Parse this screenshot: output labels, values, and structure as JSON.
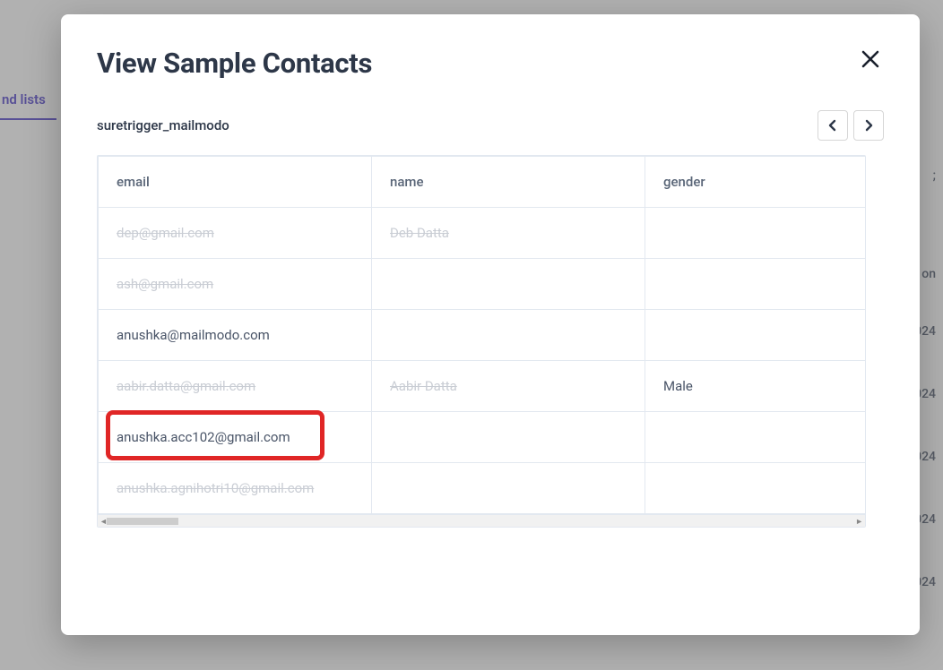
{
  "modal": {
    "title": "View Sample Contacts",
    "subtitle": "suretrigger_mailmodo"
  },
  "background": {
    "tab_label": "nd lists",
    "right_col_header": "on",
    "right_dates": [
      "024",
      "024",
      "024",
      "024",
      "024"
    ]
  },
  "table": {
    "headers": {
      "email": "email",
      "name": "name",
      "gender": "gender"
    },
    "rows": [
      {
        "email": "dep@gmail.com",
        "name": "Deb Datta",
        "gender": "",
        "email_redacted": true,
        "name_redacted": true
      },
      {
        "email": "ash@gmail.com",
        "name": "",
        "gender": "",
        "email_redacted": true,
        "name_redacted": false
      },
      {
        "email": "anushka@mailmodo.com",
        "name": "",
        "gender": "",
        "email_redacted": false,
        "name_redacted": false
      },
      {
        "email": "aabir.datta@gmail.com",
        "name": "Aabir Datta",
        "gender": "Male",
        "email_redacted": true,
        "name_redacted": true
      },
      {
        "email": "anushka.acc102@gmail.com",
        "name": "",
        "gender": "",
        "email_redacted": false,
        "name_redacted": false,
        "highlighted": true
      },
      {
        "email": "anushka.agnihotri10@gmail.com",
        "name": "",
        "gender": "",
        "email_redacted": true,
        "name_redacted": false
      }
    ]
  }
}
